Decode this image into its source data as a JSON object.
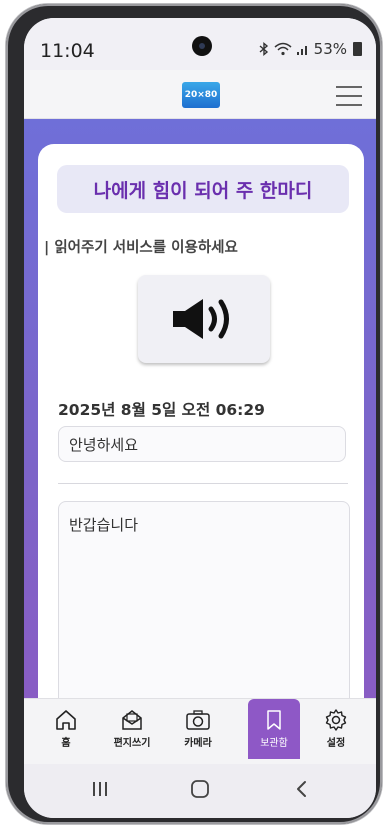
{
  "status_bar": {
    "time": "11:04",
    "battery_text": "53%"
  },
  "app_bar": {
    "logo_text": "20×80"
  },
  "main": {
    "title": "나에게 힘이 되어 주 한마디",
    "subtitle": "| 읽어주기 서비스를 이용하세요",
    "date": "2025년 8월 5일 오전 06:29",
    "greeting_value": "안녕하세요",
    "message_value": "반갑습니다"
  },
  "bottom_nav": {
    "items": [
      {
        "label": "홈",
        "icon": "home-icon"
      },
      {
        "label": "편지쓰기",
        "icon": "letter-icon"
      },
      {
        "label": "카메라",
        "icon": "camera-icon"
      },
      {
        "label": "보관함",
        "icon": "bookmark-icon",
        "active": true
      },
      {
        "label": "설정",
        "icon": "gear-icon"
      }
    ]
  },
  "colors": {
    "accent": "#8e58c6",
    "title_text": "#6a2fae",
    "gradient_top": "#6f6fd8",
    "gradient_bottom": "#8a5cc4"
  }
}
